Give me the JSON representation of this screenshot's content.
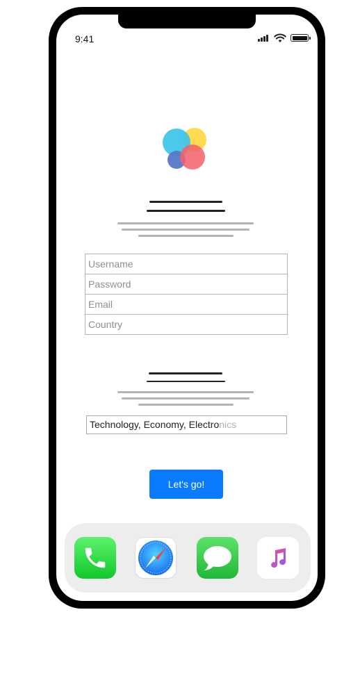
{
  "status_bar": {
    "time": "9:41"
  },
  "form": {
    "username_placeholder": "Username",
    "password_placeholder": "Password",
    "email_placeholder": "Email",
    "country_placeholder": "Country"
  },
  "interests": {
    "typed_text": "Technology, Economy, Electro",
    "suggested_completion": "nics"
  },
  "cta": {
    "label": "Let's go!"
  },
  "dock": {
    "apps": [
      "phone-icon",
      "safari-icon",
      "messages-icon",
      "music-icon"
    ]
  },
  "colors": {
    "accent": "#0a7bff",
    "phone_green": "#1fd63a",
    "messages_green": "#2bc84a",
    "logo_blue": "#3ec3ec",
    "logo_yellow": "#ffd84a",
    "logo_red": "#f35f6a",
    "logo_indigo": "#5977c9"
  }
}
